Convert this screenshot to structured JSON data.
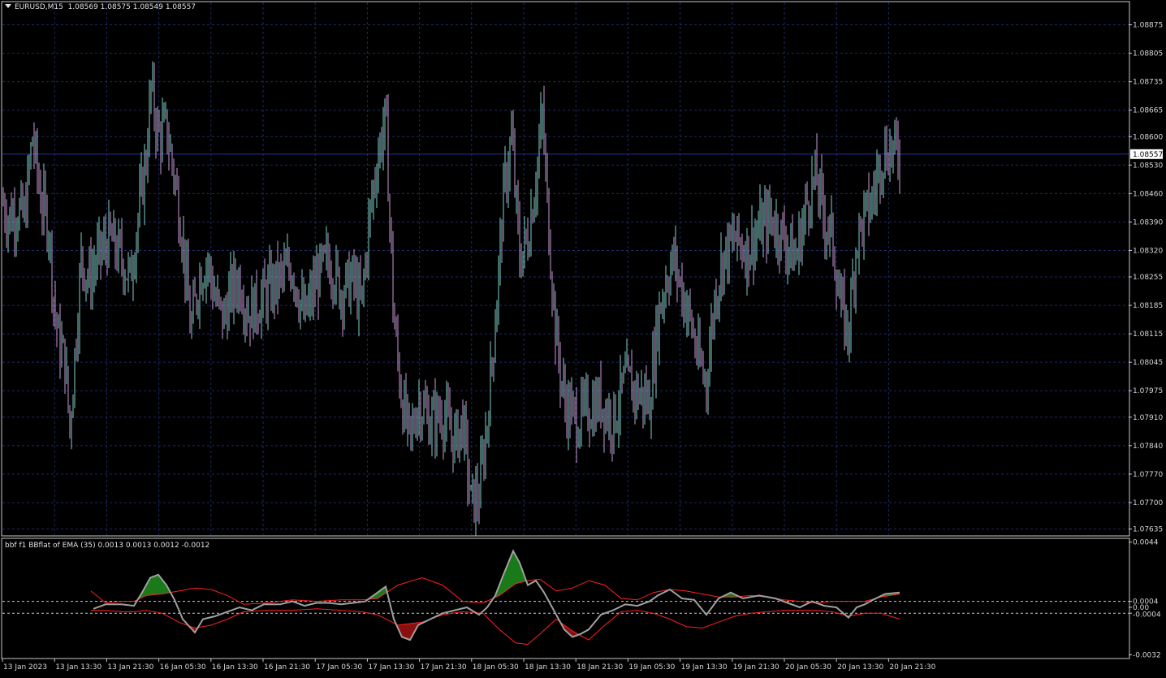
{
  "window": {
    "symbol_timeframe": "EURUSD,M15",
    "ohlc": "1.08569 1.08575 1.08549 1.08557"
  },
  "indicator": {
    "label": "bbf f1 BBflat of EMA (35) 0.0013 0.0013 0.0012 -0.0012",
    "axis_ticks": [
      "0.0044",
      "0.0004",
      "0.00",
      "-0.0004",
      "-0.0032"
    ],
    "axis_values": [
      0.0044,
      0.0004,
      0.0,
      -0.0004,
      -0.0032
    ],
    "levels": [
      0.0004,
      -0.0004
    ],
    "ylim": [
      -0.0034,
      0.0046
    ]
  },
  "price_axis": {
    "ticks": [
      "1.08875",
      "1.08805",
      "1.08735",
      "1.08665",
      "1.08600",
      "1.08530",
      "1.08460",
      "1.08390",
      "1.08320",
      "1.08255",
      "1.08185",
      "1.08115",
      "1.08045",
      "1.07975",
      "1.07910",
      "1.07840",
      "1.07770",
      "1.07700",
      "1.07635"
    ],
    "current_price": "1.08557",
    "ylim": [
      1.0762,
      1.0893
    ]
  },
  "time_axis": {
    "labels": [
      "13 Jan 2023",
      "13 Jan 13:30",
      "13 Jan 21:30",
      "16 Jan 05:30",
      "16 Jan 13:30",
      "16 Jan 21:30",
      "17 Jan 05:30",
      "17 Jan 13:30",
      "17 Jan 21:30",
      "18 Jan 05:30",
      "18 Jan 13:30",
      "18 Jan 21:30",
      "19 Jan 05:30",
      "19 Jan 13:30",
      "19 Jan 21:30",
      "20 Jan 05:30",
      "20 Jan 13:30",
      "20 Jan 21:30"
    ]
  },
  "chart_data": {
    "type": "bar",
    "symbol": "EURUSD",
    "timeframe": "M15",
    "price_series_close": [
      [
        0,
        1.0846
      ],
      [
        10,
        1.084
      ],
      [
        20,
        1.0842
      ],
      [
        30,
        1.084
      ],
      [
        40,
        1.086
      ],
      [
        50,
        1.0845
      ],
      [
        60,
        1.0838
      ],
      [
        66,
        1.082
      ],
      [
        72,
        1.081
      ],
      [
        80,
        1.0805
      ],
      [
        86,
        1.0788
      ],
      [
        95,
        1.0815
      ],
      [
        100,
        1.083
      ],
      [
        110,
        1.0825
      ],
      [
        120,
        1.083
      ],
      [
        135,
        1.0835
      ],
      [
        150,
        1.083
      ],
      [
        160,
        1.0825
      ],
      [
        170,
        1.084
      ],
      [
        180,
        1.0855
      ],
      [
        186,
        1.0872
      ],
      [
        195,
        1.086
      ],
      [
        205,
        1.0862
      ],
      [
        215,
        1.085
      ],
      [
        225,
        1.0835
      ],
      [
        235,
        1.0812
      ],
      [
        245,
        1.0825
      ],
      [
        255,
        1.083
      ],
      [
        265,
        1.082
      ],
      [
        275,
        1.0815
      ],
      [
        285,
        1.0822
      ],
      [
        295,
        1.0825
      ],
      [
        305,
        1.0817
      ],
      [
        315,
        1.0818
      ],
      [
        330,
        1.0822
      ],
      [
        345,
        1.0825
      ],
      [
        360,
        1.0828
      ],
      [
        375,
        1.0815
      ],
      [
        390,
        1.0825
      ],
      [
        405,
        1.083
      ],
      [
        420,
        1.0822
      ],
      [
        435,
        1.0825
      ],
      [
        445,
        1.0818
      ],
      [
        455,
        1.084
      ],
      [
        465,
        1.0855
      ],
      [
        475,
        1.0865
      ],
      [
        485,
        1.0815
      ],
      [
        495,
        1.0795
      ],
      [
        505,
        1.0785
      ],
      [
        515,
        1.0795
      ],
      [
        530,
        1.079
      ],
      [
        545,
        1.0792
      ],
      [
        560,
        1.0785
      ],
      [
        570,
        1.079
      ],
      [
        580,
        1.077
      ],
      [
        590,
        1.0772
      ],
      [
        600,
        1.079
      ],
      [
        610,
        1.0815
      ],
      [
        620,
        1.0845
      ],
      [
        630,
        1.086
      ],
      [
        640,
        1.083
      ],
      [
        650,
        1.0835
      ],
      [
        660,
        1.085
      ],
      [
        668,
        1.0865
      ],
      [
        675,
        1.084
      ],
      [
        685,
        1.081
      ],
      [
        695,
        1.0795
      ],
      [
        710,
        1.079
      ],
      [
        725,
        1.0793
      ],
      [
        740,
        1.0795
      ],
      [
        755,
        1.079
      ],
      [
        770,
        1.08
      ],
      [
        785,
        1.0797
      ],
      [
        800,
        1.0795
      ],
      [
        810,
        1.0815
      ],
      [
        820,
        1.0825
      ],
      [
        830,
        1.083
      ],
      [
        840,
        1.0822
      ],
      [
        850,
        1.0815
      ],
      [
        860,
        1.0805
      ],
      [
        870,
        1.08
      ],
      [
        880,
        1.082
      ],
      [
        890,
        1.083
      ],
      [
        905,
        1.0835
      ],
      [
        920,
        1.0832
      ],
      [
        935,
        1.0837
      ],
      [
        950,
        1.084
      ],
      [
        965,
        1.0835
      ],
      [
        980,
        1.083
      ],
      [
        995,
        1.0845
      ],
      [
        1005,
        1.085
      ],
      [
        1015,
        1.084
      ],
      [
        1025,
        1.0835
      ],
      [
        1035,
        1.0818
      ],
      [
        1045,
        1.0812
      ],
      [
        1055,
        1.0835
      ],
      [
        1065,
        1.084
      ],
      [
        1075,
        1.0845
      ],
      [
        1085,
        1.0855
      ],
      [
        1095,
        1.0857
      ],
      [
        1108,
        1.0856
      ]
    ],
    "indicator_main": [
      [
        115,
        -0.0001
      ],
      [
        130,
        0.0002
      ],
      [
        150,
        0.0002
      ],
      [
        165,
        0.0001
      ],
      [
        175,
        0.001
      ],
      [
        185,
        0.002
      ],
      [
        195,
        0.0022
      ],
      [
        205,
        0.0015
      ],
      [
        215,
        0.0005
      ],
      [
        225,
        -0.0008
      ],
      [
        240,
        -0.0017
      ],
      [
        250,
        -0.0008
      ],
      [
        265,
        -0.0006
      ],
      [
        280,
        -0.0003
      ],
      [
        295,
        0.0
      ],
      [
        310,
        -0.0002
      ],
      [
        325,
        0.0002
      ],
      [
        345,
        0.0002
      ],
      [
        360,
        0.0004
      ],
      [
        375,
        0.0001
      ],
      [
        390,
        0.0003
      ],
      [
        405,
        0.0003
      ],
      [
        420,
        0.0002
      ],
      [
        435,
        0.0003
      ],
      [
        450,
        0.0004
      ],
      [
        465,
        0.001
      ],
      [
        475,
        0.0014
      ],
      [
        485,
        -0.0008
      ],
      [
        495,
        -0.002
      ],
      [
        505,
        -0.0022
      ],
      [
        515,
        -0.0012
      ],
      [
        530,
        -0.0008
      ],
      [
        545,
        -0.0004
      ],
      [
        560,
        -0.0002
      ],
      [
        575,
        0.0
      ],
      [
        590,
        -0.0005
      ],
      [
        600,
        0.0
      ],
      [
        610,
        0.0008
      ],
      [
        620,
        0.0022
      ],
      [
        632,
        0.0038
      ],
      [
        640,
        0.003
      ],
      [
        650,
        0.0015
      ],
      [
        660,
        0.0018
      ],
      [
        670,
        0.001
      ],
      [
        685,
        -0.0005
      ],
      [
        695,
        -0.0015
      ],
      [
        705,
        -0.002
      ],
      [
        715,
        -0.0018
      ],
      [
        725,
        -0.0015
      ],
      [
        740,
        -0.0005
      ],
      [
        755,
        -0.0002
      ],
      [
        770,
        0.0002
      ],
      [
        785,
        0.0001
      ],
      [
        800,
        0.0004
      ],
      [
        810,
        0.0008
      ],
      [
        825,
        0.0012
      ],
      [
        840,
        0.0006
      ],
      [
        855,
        0.0005
      ],
      [
        870,
        -0.0005
      ],
      [
        885,
        0.0006
      ],
      [
        900,
        0.001
      ],
      [
        915,
        0.0006
      ],
      [
        935,
        0.0008
      ],
      [
        955,
        0.0006
      ],
      [
        970,
        0.0003
      ],
      [
        985,
        0.0
      ],
      [
        1000,
        0.0004
      ],
      [
        1015,
        0.0001
      ],
      [
        1030,
        0.0
      ],
      [
        1045,
        -0.0007
      ],
      [
        1055,
        0.0
      ],
      [
        1065,
        0.0002
      ],
      [
        1075,
        0.0005
      ],
      [
        1090,
        0.0009
      ],
      [
        1108,
        0.001
      ]
    ],
    "indicator_upper_band": [
      [
        112,
        0.0011
      ],
      [
        130,
        0.0003
      ],
      [
        150,
        0.0004
      ],
      [
        165,
        0.0004
      ],
      [
        180,
        0.0008
      ],
      [
        200,
        0.0009
      ],
      [
        220,
        0.0011
      ],
      [
        240,
        0.0013
      ],
      [
        260,
        0.0012
      ],
      [
        280,
        0.0008
      ],
      [
        300,
        0.0002
      ],
      [
        330,
        0.0003
      ],
      [
        360,
        0.0005
      ],
      [
        390,
        0.0004
      ],
      [
        420,
        0.0005
      ],
      [
        445,
        0.0005
      ],
      [
        465,
        0.0006
      ],
      [
        490,
        0.0015
      ],
      [
        520,
        0.002
      ],
      [
        545,
        0.0015
      ],
      [
        570,
        0.0004
      ],
      [
        595,
        0.0003
      ],
      [
        615,
        0.0008
      ],
      [
        635,
        0.0016
      ],
      [
        650,
        0.0018
      ],
      [
        665,
        0.0019
      ],
      [
        685,
        0.0011
      ],
      [
        705,
        0.0013
      ],
      [
        725,
        0.0018
      ],
      [
        745,
        0.0015
      ],
      [
        765,
        0.0006
      ],
      [
        785,
        0.0005
      ],
      [
        805,
        0.001
      ],
      [
        825,
        0.0012
      ],
      [
        845,
        0.0011
      ],
      [
        865,
        0.0009
      ],
      [
        885,
        0.0007
      ],
      [
        905,
        0.0007
      ],
      [
        925,
        0.0008
      ],
      [
        945,
        0.0007
      ],
      [
        965,
        0.0005
      ],
      [
        985,
        0.0004
      ],
      [
        1005,
        0.0003
      ],
      [
        1025,
        0.0004
      ],
      [
        1045,
        0.0004
      ],
      [
        1065,
        0.0004
      ],
      [
        1085,
        0.0007
      ],
      [
        1108,
        0.0009
      ]
    ],
    "indicator_lower_band": [
      [
        112,
        -0.0002
      ],
      [
        130,
        -0.0002
      ],
      [
        150,
        -0.0003
      ],
      [
        165,
        -0.0003
      ],
      [
        180,
        -0.0002
      ],
      [
        200,
        -0.0004
      ],
      [
        220,
        -0.001
      ],
      [
        240,
        -0.0014
      ],
      [
        260,
        -0.0012
      ],
      [
        280,
        -0.0008
      ],
      [
        300,
        -0.0003
      ],
      [
        330,
        -0.0002
      ],
      [
        360,
        -0.0002
      ],
      [
        390,
        -0.0001
      ],
      [
        420,
        -0.0002
      ],
      [
        445,
        -0.0003
      ],
      [
        465,
        -0.0005
      ],
      [
        490,
        -0.0012
      ],
      [
        520,
        -0.001
      ],
      [
        545,
        -0.0005
      ],
      [
        570,
        -0.0003
      ],
      [
        595,
        -0.0004
      ],
      [
        615,
        -0.0015
      ],
      [
        635,
        -0.0024
      ],
      [
        650,
        -0.0025
      ],
      [
        665,
        -0.0018
      ],
      [
        685,
        -0.0008
      ],
      [
        705,
        -0.0016
      ],
      [
        725,
        -0.0022
      ],
      [
        745,
        -0.0012
      ],
      [
        765,
        -0.0003
      ],
      [
        785,
        -0.0002
      ],
      [
        805,
        -0.0004
      ],
      [
        825,
        -0.0008
      ],
      [
        845,
        -0.0013
      ],
      [
        865,
        -0.0014
      ],
      [
        885,
        -0.001
      ],
      [
        905,
        -0.0006
      ],
      [
        925,
        -0.0004
      ],
      [
        945,
        -0.0003
      ],
      [
        965,
        -0.0002
      ],
      [
        985,
        -0.0002
      ],
      [
        1005,
        -0.0002
      ],
      [
        1025,
        -0.0003
      ],
      [
        1045,
        -0.0006
      ],
      [
        1065,
        -0.0004
      ],
      [
        1085,
        -0.0004
      ],
      [
        1108,
        -0.0008
      ]
    ]
  },
  "colors": {
    "background": "#000000",
    "grid": "#1d2a66",
    "bull_bar": "#7fd1c9",
    "bear_bar": "#c99ad6",
    "current_price_line": "#2233aa",
    "indicator_main": "#a0a0a0",
    "bands": "#ff2020",
    "fill_up": "#1a7a1a",
    "fill_down": "#8a1010",
    "level_lines": "#cccccc"
  }
}
